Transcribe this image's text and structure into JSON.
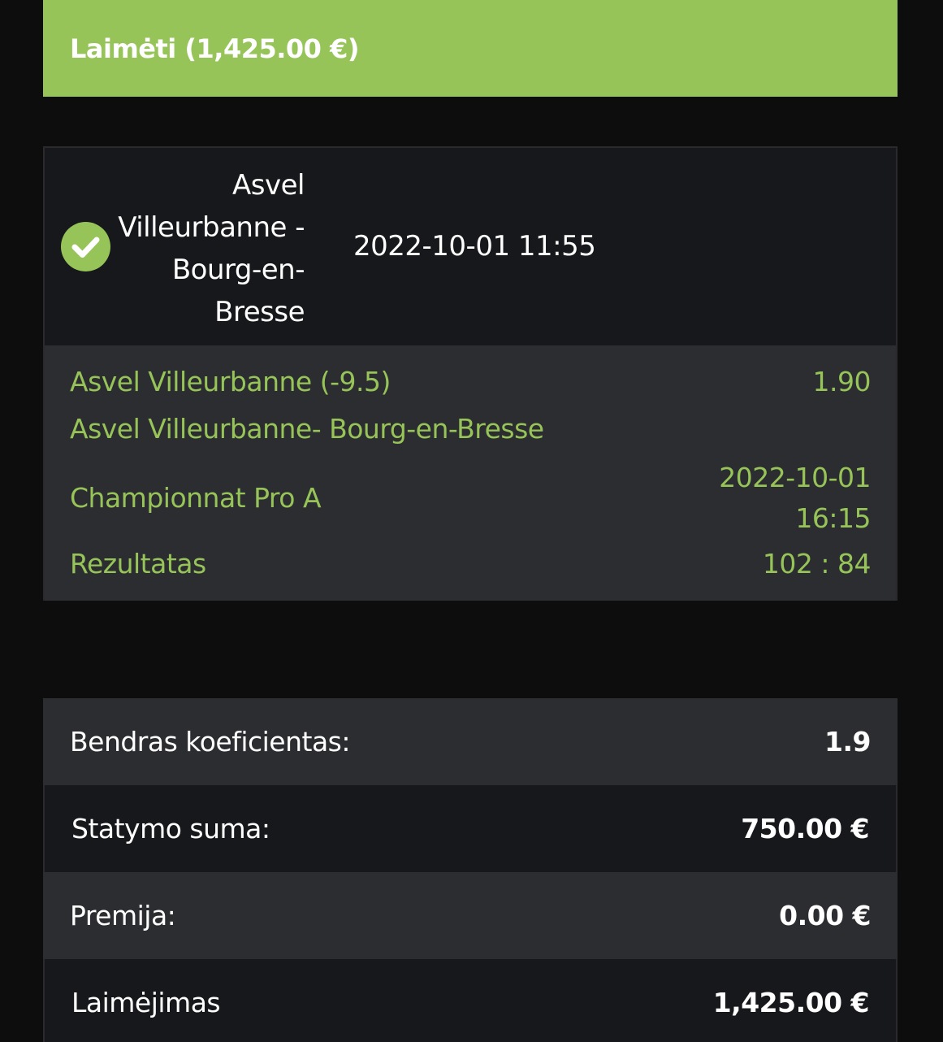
{
  "status": {
    "label": "Laimėti (1,425.00 €)",
    "color": "#97c458"
  },
  "bet": {
    "event_name": "Asvel Villeurbanne - Bourg-en-Bresse",
    "placed_at": "2022-10-01 11:55",
    "status_icon": "check-circle-icon",
    "selection": {
      "pick": "Asvel Villeurbanne (-9.5)",
      "odds": "1.90",
      "event": "Asvel Villeurbanne- Bourg-en-Bresse",
      "league": "Championnat Pro A",
      "event_date": "2022-10-01",
      "event_time": "16:15",
      "result_label": "Rezultatas",
      "result_value": "102 : 84"
    }
  },
  "summary": {
    "total_odds_label": "Bendras koeficientas:",
    "total_odds_value": "1.9",
    "stake_label": "Statymo suma:",
    "stake_value": "750.00 €",
    "bonus_label": "Premija:",
    "bonus_value": "0.00 €",
    "winnings_label": "Laimėjimas",
    "winnings_value": "1,425.00 €"
  },
  "colors": {
    "accent": "#97c458",
    "background": "#0d0d0d",
    "panel_dark": "#17181b",
    "panel_light": "#2c2d30"
  }
}
